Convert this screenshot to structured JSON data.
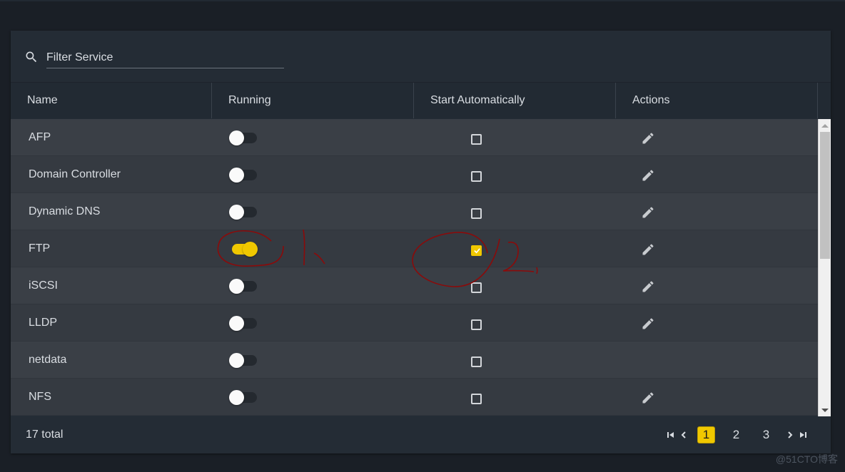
{
  "filter": {
    "placeholder": "Filter Service",
    "value": ""
  },
  "table": {
    "columns": [
      "Name",
      "Running",
      "Start Automatically",
      "Actions"
    ],
    "rows": [
      {
        "name": "AFP",
        "running": false,
        "start_automatically": false,
        "editable": true
      },
      {
        "name": "Domain Controller",
        "running": false,
        "start_automatically": false,
        "editable": true
      },
      {
        "name": "Dynamic DNS",
        "running": false,
        "start_automatically": false,
        "editable": true
      },
      {
        "name": "FTP",
        "running": true,
        "start_automatically": true,
        "editable": true
      },
      {
        "name": "iSCSI",
        "running": false,
        "start_automatically": false,
        "editable": true
      },
      {
        "name": "LLDP",
        "running": false,
        "start_automatically": false,
        "editable": true
      },
      {
        "name": "netdata",
        "running": false,
        "start_automatically": false,
        "editable": false
      },
      {
        "name": "NFS",
        "running": false,
        "start_automatically": false,
        "editable": true
      }
    ]
  },
  "footer": {
    "total": "17 total",
    "pages": [
      "1",
      "2",
      "3"
    ],
    "current_page": "1"
  },
  "annotations": {
    "label_1": "1,",
    "label_2": "2,"
  },
  "colors": {
    "accent": "#f0c800",
    "annotation": "#8b0a0a"
  },
  "watermark": "@51CTO博客"
}
